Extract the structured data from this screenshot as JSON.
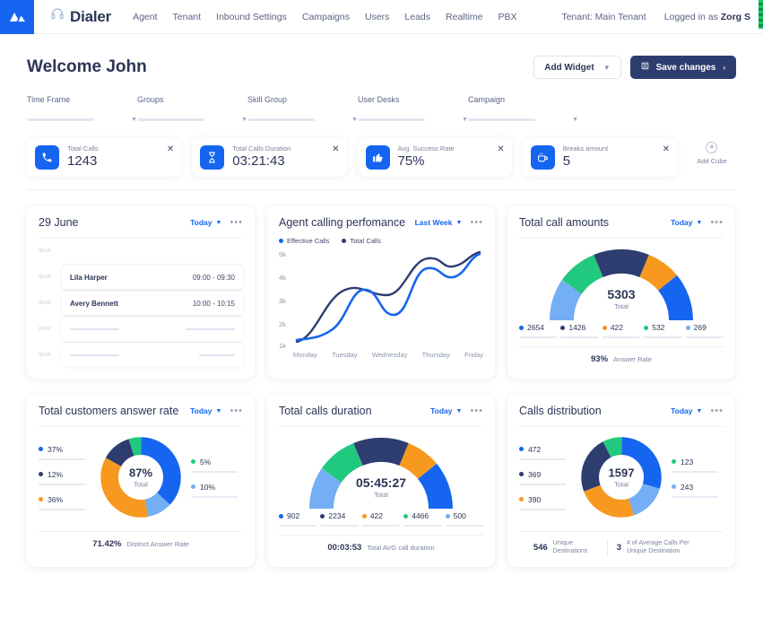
{
  "header": {
    "logo_icon": "logo-mountain-icon",
    "headset_icon": "headset-icon",
    "brand": "Dialer",
    "nav": [
      {
        "label": "Agent"
      },
      {
        "label": "Tenant"
      },
      {
        "label": "Inbound Settings"
      },
      {
        "label": "Campaigns"
      },
      {
        "label": "Users"
      },
      {
        "label": "Leads"
      },
      {
        "label": "Realtime"
      },
      {
        "label": "PBX"
      }
    ],
    "tenant_text": "Tenant: Main Tenant",
    "logged_in_prefix": "Logged in as ",
    "logged_in_user": "Zorg S"
  },
  "page": {
    "title": "Welcome John",
    "add_widget_label": "Add Widget",
    "save_label": "Save changes"
  },
  "filters": [
    {
      "label": "Time Frame",
      "value": ""
    },
    {
      "label": "Groups",
      "value": ""
    },
    {
      "label": "Skill Group",
      "value": ""
    },
    {
      "label": "User Desks",
      "value": ""
    },
    {
      "label": "Campaign",
      "value": ""
    }
  ],
  "kpis": [
    {
      "label": "Total Calls",
      "value": "1243",
      "icon": "phone-icon"
    },
    {
      "label": "Total Calls Duration",
      "value": "03:21:43",
      "icon": "hourglass-icon"
    },
    {
      "label": "Avg. Success Rate",
      "value": "75%",
      "icon": "thumbs-up-icon"
    },
    {
      "label": "Breaks amount",
      "value": "5",
      "icon": "coffee-cup-icon"
    }
  ],
  "add_cube_label": "Add Cube",
  "schedule": {
    "title": "29 June",
    "period": "Today",
    "rows": [
      {
        "time": "08:00",
        "name": "",
        "range": "",
        "empty": true,
        "hidden_card": true
      },
      {
        "time": "09:00",
        "name": "Lila Harper",
        "range": "09:00 - 09:30",
        "empty": false
      },
      {
        "time": "09:00",
        "name": "Avery Bennett",
        "range": "10:00 - 10:15",
        "empty": false
      },
      {
        "time": "09:00",
        "name": "",
        "range": "",
        "empty": true
      },
      {
        "time": "09:00",
        "name": "",
        "range": "",
        "empty": true
      }
    ]
  },
  "chart_data": [
    {
      "id": "agent-calling-performance",
      "type": "line",
      "title": "Agent calling perfomance",
      "period": "Last Week",
      "categories": [
        "Monday",
        "Tuesday",
        "Wednesday",
        "Thursday",
        "Friday"
      ],
      "ytick_labels": [
        "5k",
        "4k",
        "3k",
        "2k",
        "1k"
      ],
      "ylim": [
        1000,
        5500
      ],
      "grid": false,
      "legend_position": "top-left",
      "series": [
        {
          "name": "Effective Calls",
          "color": "#1565f0",
          "values": [
            1250,
            3950,
            3800,
            4900,
            5200
          ]
        },
        {
          "name": "Total Calls",
          "color": "#2e3d70",
          "values": [
            1750,
            3000,
            2000,
            4800,
            5250
          ]
        }
      ]
    },
    {
      "id": "total-call-amounts",
      "type": "pie",
      "shape": "gauge",
      "title": "Total call amounts",
      "period": "Today",
      "center_value": "5303",
      "center_label": "Total",
      "values": [
        2654,
        1426,
        422,
        532,
        269
      ],
      "labels": [
        "2654",
        "1426",
        "422",
        "532",
        "269"
      ],
      "colors": [
        "#1565f0",
        "#2e3d70",
        "#f7991f",
        "#21c97e",
        "#74aef5"
      ],
      "footer": [
        {
          "value": "93%",
          "label": "Answer Rate"
        }
      ]
    },
    {
      "id": "total-customers-answer-rate",
      "type": "pie",
      "shape": "donut",
      "title": "Total customers answer rate",
      "period": "Today",
      "center_value": "87%",
      "center_label": "Total",
      "values": [
        37,
        10,
        36,
        12,
        5
      ],
      "labels_left": [
        "37%",
        "12%",
        "36%"
      ],
      "labels_right": [
        "5%",
        "10%"
      ],
      "colors_left": [
        "#1565f0",
        "#2e3d70",
        "#f7991f"
      ],
      "colors_right": [
        "#21c97e",
        "#74aef5"
      ],
      "colors": [
        "#1565f0",
        "#74aef5",
        "#f7991f",
        "#2e3d70",
        "#21c97e"
      ],
      "footer": [
        {
          "value": "71.42%",
          "label": "Distinct Answer Rate"
        }
      ]
    },
    {
      "id": "total-calls-duration",
      "type": "pie",
      "shape": "gauge",
      "title": "Total calls duration",
      "period": "Today",
      "center_value": "05:45:27",
      "center_label": "Total",
      "values": [
        902,
        2234,
        422,
        4466,
        500
      ],
      "labels": [
        "902",
        "2234",
        "422",
        "4466",
        "500"
      ],
      "colors": [
        "#1565f0",
        "#2e3d70",
        "#f7991f",
        "#21c97e",
        "#74aef5"
      ],
      "footer": [
        {
          "value": "00:03:53",
          "label": "Total AVG call duration"
        }
      ]
    },
    {
      "id": "calls-distribution",
      "type": "pie",
      "shape": "donut",
      "title": "Calls distribution",
      "period": "Today",
      "center_value": "1597",
      "center_label": "Total",
      "values": [
        472,
        243,
        390,
        369,
        123
      ],
      "labels_left": [
        "472",
        "369",
        "390"
      ],
      "labels_right": [
        "123",
        "243"
      ],
      "colors_left": [
        "#1565f0",
        "#2e3d70",
        "#f7991f"
      ],
      "colors_right": [
        "#21c97e",
        "#74aef5"
      ],
      "colors": [
        "#1565f0",
        "#74aef5",
        "#f7991f",
        "#2e3d70",
        "#21c97e"
      ],
      "footer": [
        {
          "value": "546",
          "label": "Unique Destinations"
        },
        {
          "value": "3",
          "label": "# of Average Calls Per Unique Destination"
        }
      ]
    }
  ],
  "colors": {
    "accent": "#1565f0",
    "navy": "#2e3d70",
    "orange": "#f7991f",
    "green": "#21c97e",
    "light_blue": "#74aef5",
    "text": "#2c3557"
  }
}
